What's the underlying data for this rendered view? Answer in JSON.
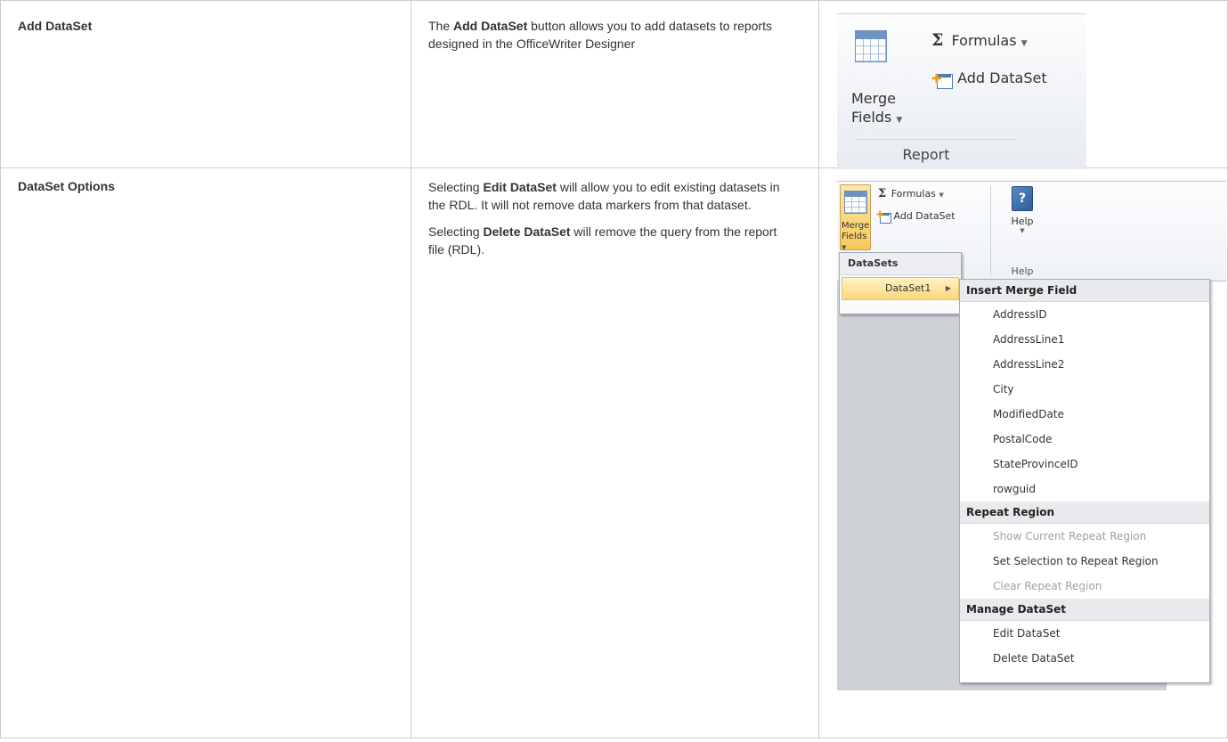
{
  "rows": [
    {
      "title": "Add DataSet",
      "description": {
        "pre": "The ",
        "bold": "Add DataSet",
        "post": " button allows you to add datasets to reports designed in the OfficeWriter Designer"
      },
      "ribbon": {
        "formulas_label": "Formulas",
        "add_dataset_label": "Add DataSet",
        "merge_label": "Merge",
        "fields_label": "Fields",
        "group_label": "Report"
      }
    },
    {
      "title": "DataSet Options",
      "description": {
        "p1_pre": "Selecting ",
        "p1_bold": "Edit DataSet",
        "p1_post": " will allow you to edit existing datasets in the RDL. It will not remove data markers from that dataset.",
        "p2_pre": "Selecting ",
        "p2_bold": "Delete DataSet",
        "p2_post": " will remove the query from the report file (RDL)."
      },
      "ribbon": {
        "formulas_label": "Formulas",
        "add_dataset_label": "Add DataSet",
        "merge_label": "Merge",
        "fields_label": "Fields",
        "help_label": "Help",
        "help_group_label": "Help"
      },
      "menu": {
        "header": "DataSets",
        "dataset_item": "DataSet1",
        "submenu": {
          "insert_header": "Insert Merge Field",
          "fields": [
            "AddressID",
            "AddressLine1",
            "AddressLine2",
            "City",
            "ModifiedDate",
            "PostalCode",
            "StateProvinceID",
            "rowguid"
          ],
          "repeat_header": "Repeat Region",
          "repeat_items": [
            {
              "label": "Show Current Repeat Region",
              "disabled": true
            },
            {
              "label": "Set Selection to Repeat Region",
              "disabled": false
            },
            {
              "label": "Clear Repeat Region",
              "disabled": true
            }
          ],
          "manage_header": "Manage DataSet",
          "manage_items": [
            "Edit DataSet",
            "Delete DataSet"
          ]
        }
      }
    }
  ],
  "icons": [
    "sigma-icon",
    "dropdown-arrow-icon",
    "add-dataset-icon",
    "merge-fields-table-icon",
    "help-book-icon",
    "submenu-arrow-icon"
  ]
}
